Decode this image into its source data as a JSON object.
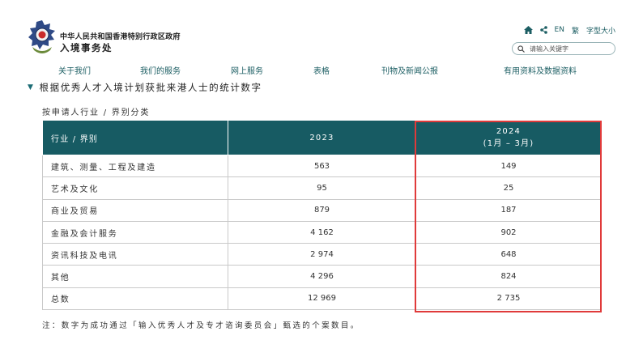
{
  "site": {
    "org_name": "中华人民共和国香港特别行政区政府",
    "dept_name": "入境事务处"
  },
  "utility": {
    "home_icon": "home-icon",
    "share_icon": "share-icon",
    "lang_label": "EN",
    "trad_chinese_label": "繁",
    "font_size_label": "字型大小"
  },
  "search": {
    "placeholder": "请输入关键字"
  },
  "nav": {
    "items": [
      "关于我们",
      "我们的服务",
      "网上服务",
      "表格",
      "刊物及新闻公报",
      "有用资料及数据资料"
    ]
  },
  "page": {
    "title": "根据优秀人才入境计划获批来港人士的统计数字",
    "subtitle": "按申请人行业 / 界别分类"
  },
  "table": {
    "headers": {
      "industry": "行业 / 界别",
      "col_2023": "2023",
      "col_2024": "2024",
      "col_2024_sub": "(1月 – 3月)"
    },
    "rows": [
      {
        "label": "建筑、测量、工程及建造",
        "v2023": "563",
        "v2024": "149"
      },
      {
        "label": "艺术及文化",
        "v2023": "95",
        "v2024": "25"
      },
      {
        "label": "商业及贸易",
        "v2023": "879",
        "v2024": "187"
      },
      {
        "label": "金融及会计服务",
        "v2023": "4 162",
        "v2024": "902"
      },
      {
        "label": "资讯科技及电讯",
        "v2023": "2 974",
        "v2024": "648"
      },
      {
        "label": "其他",
        "v2023": "4 296",
        "v2024": "824"
      },
      {
        "label": "总数",
        "v2023": "12 969",
        "v2024": "2 735"
      }
    ]
  },
  "note": "注：数字为成功通过「输入优秀人才及专才谘询委员会」甄选的个案数目。",
  "colors": {
    "accent": "#175b63",
    "highlight": "#e03a3a"
  }
}
